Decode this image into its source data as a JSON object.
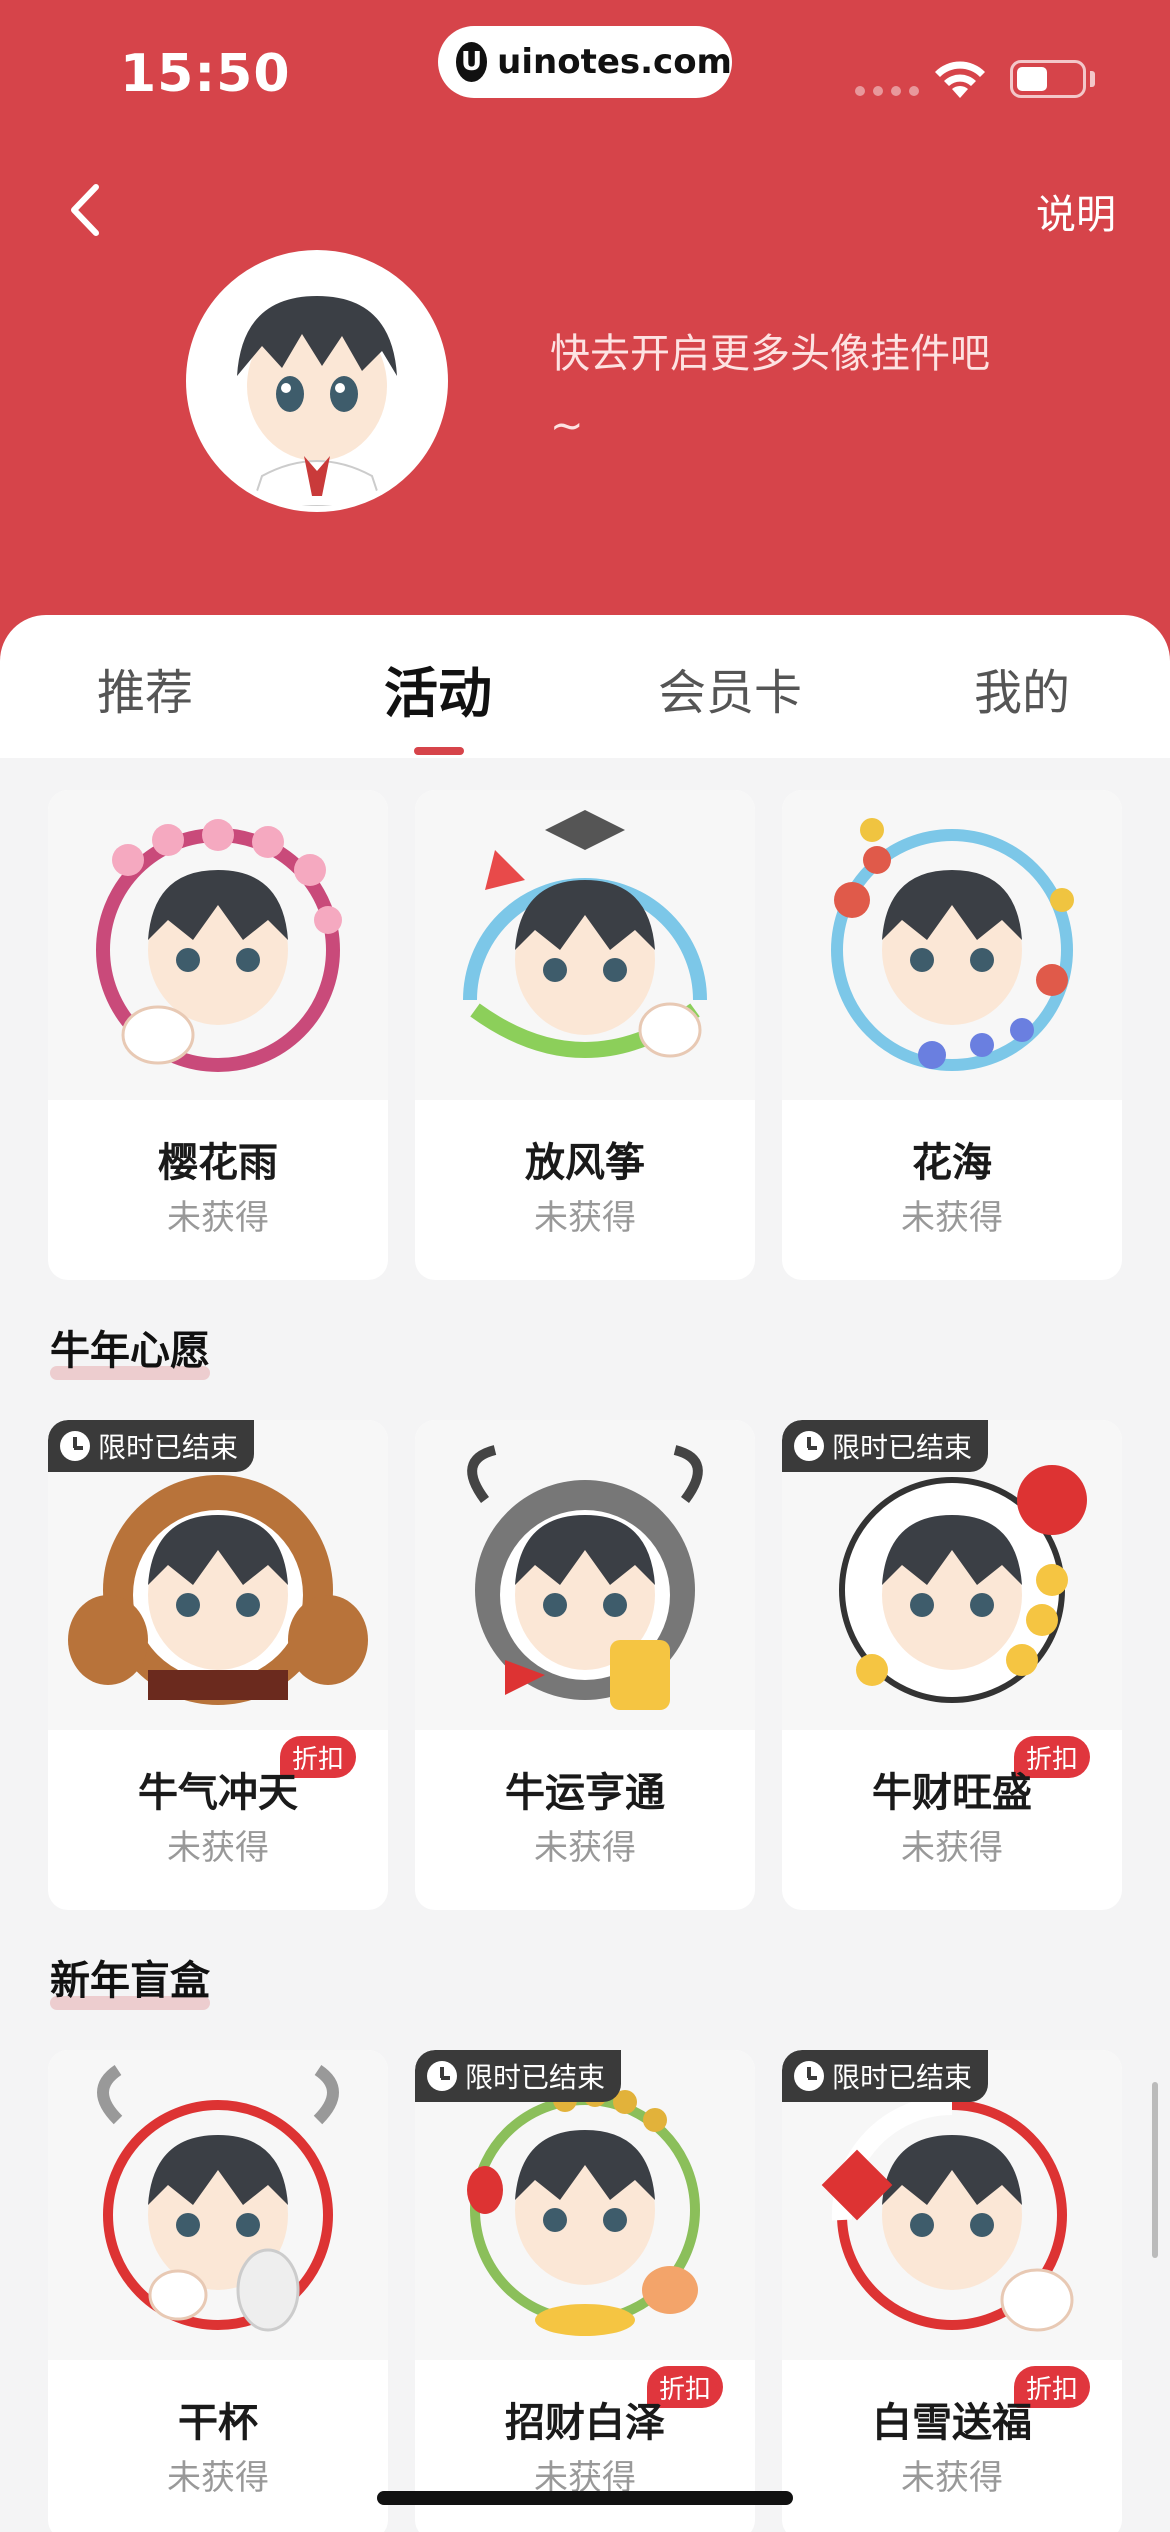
{
  "status_bar": {
    "time": "15:50",
    "url": "uinotes.com",
    "url_logo": "U"
  },
  "header": {
    "help_label": "说明",
    "promo_line1": "快去开启更多头像挂件吧",
    "promo_line2": "~"
  },
  "tabs": [
    {
      "label": "推荐"
    },
    {
      "label": "活动"
    },
    {
      "label": "会员卡"
    },
    {
      "label": "我的"
    }
  ],
  "active_tab": "活动",
  "colors": {
    "brand_red": "#d6444a",
    "discount_red": "#e0363d",
    "ended_badge": "#3a3a3a"
  },
  "badges": {
    "ended": "限时已结束",
    "discount": "折扣"
  },
  "sections": [
    {
      "title": "",
      "items": [
        {
          "name": "樱花雨",
          "status": "未获得"
        },
        {
          "name": "放风筝",
          "status": "未获得"
        },
        {
          "name": "花海",
          "status": "未获得"
        }
      ]
    },
    {
      "title": "牛年心愿",
      "items": [
        {
          "name": "牛气冲天",
          "status": "未获得"
        },
        {
          "name": "牛运亨通",
          "status": "未获得"
        },
        {
          "name": "牛财旺盛",
          "status": "未获得"
        }
      ]
    },
    {
      "title": "新年盲盒",
      "items": [
        {
          "name": "干杯",
          "status": "未获得"
        },
        {
          "name": "招财白泽",
          "status": "未获得"
        },
        {
          "name": "白雪送福",
          "status": "未获得"
        }
      ]
    }
  ]
}
